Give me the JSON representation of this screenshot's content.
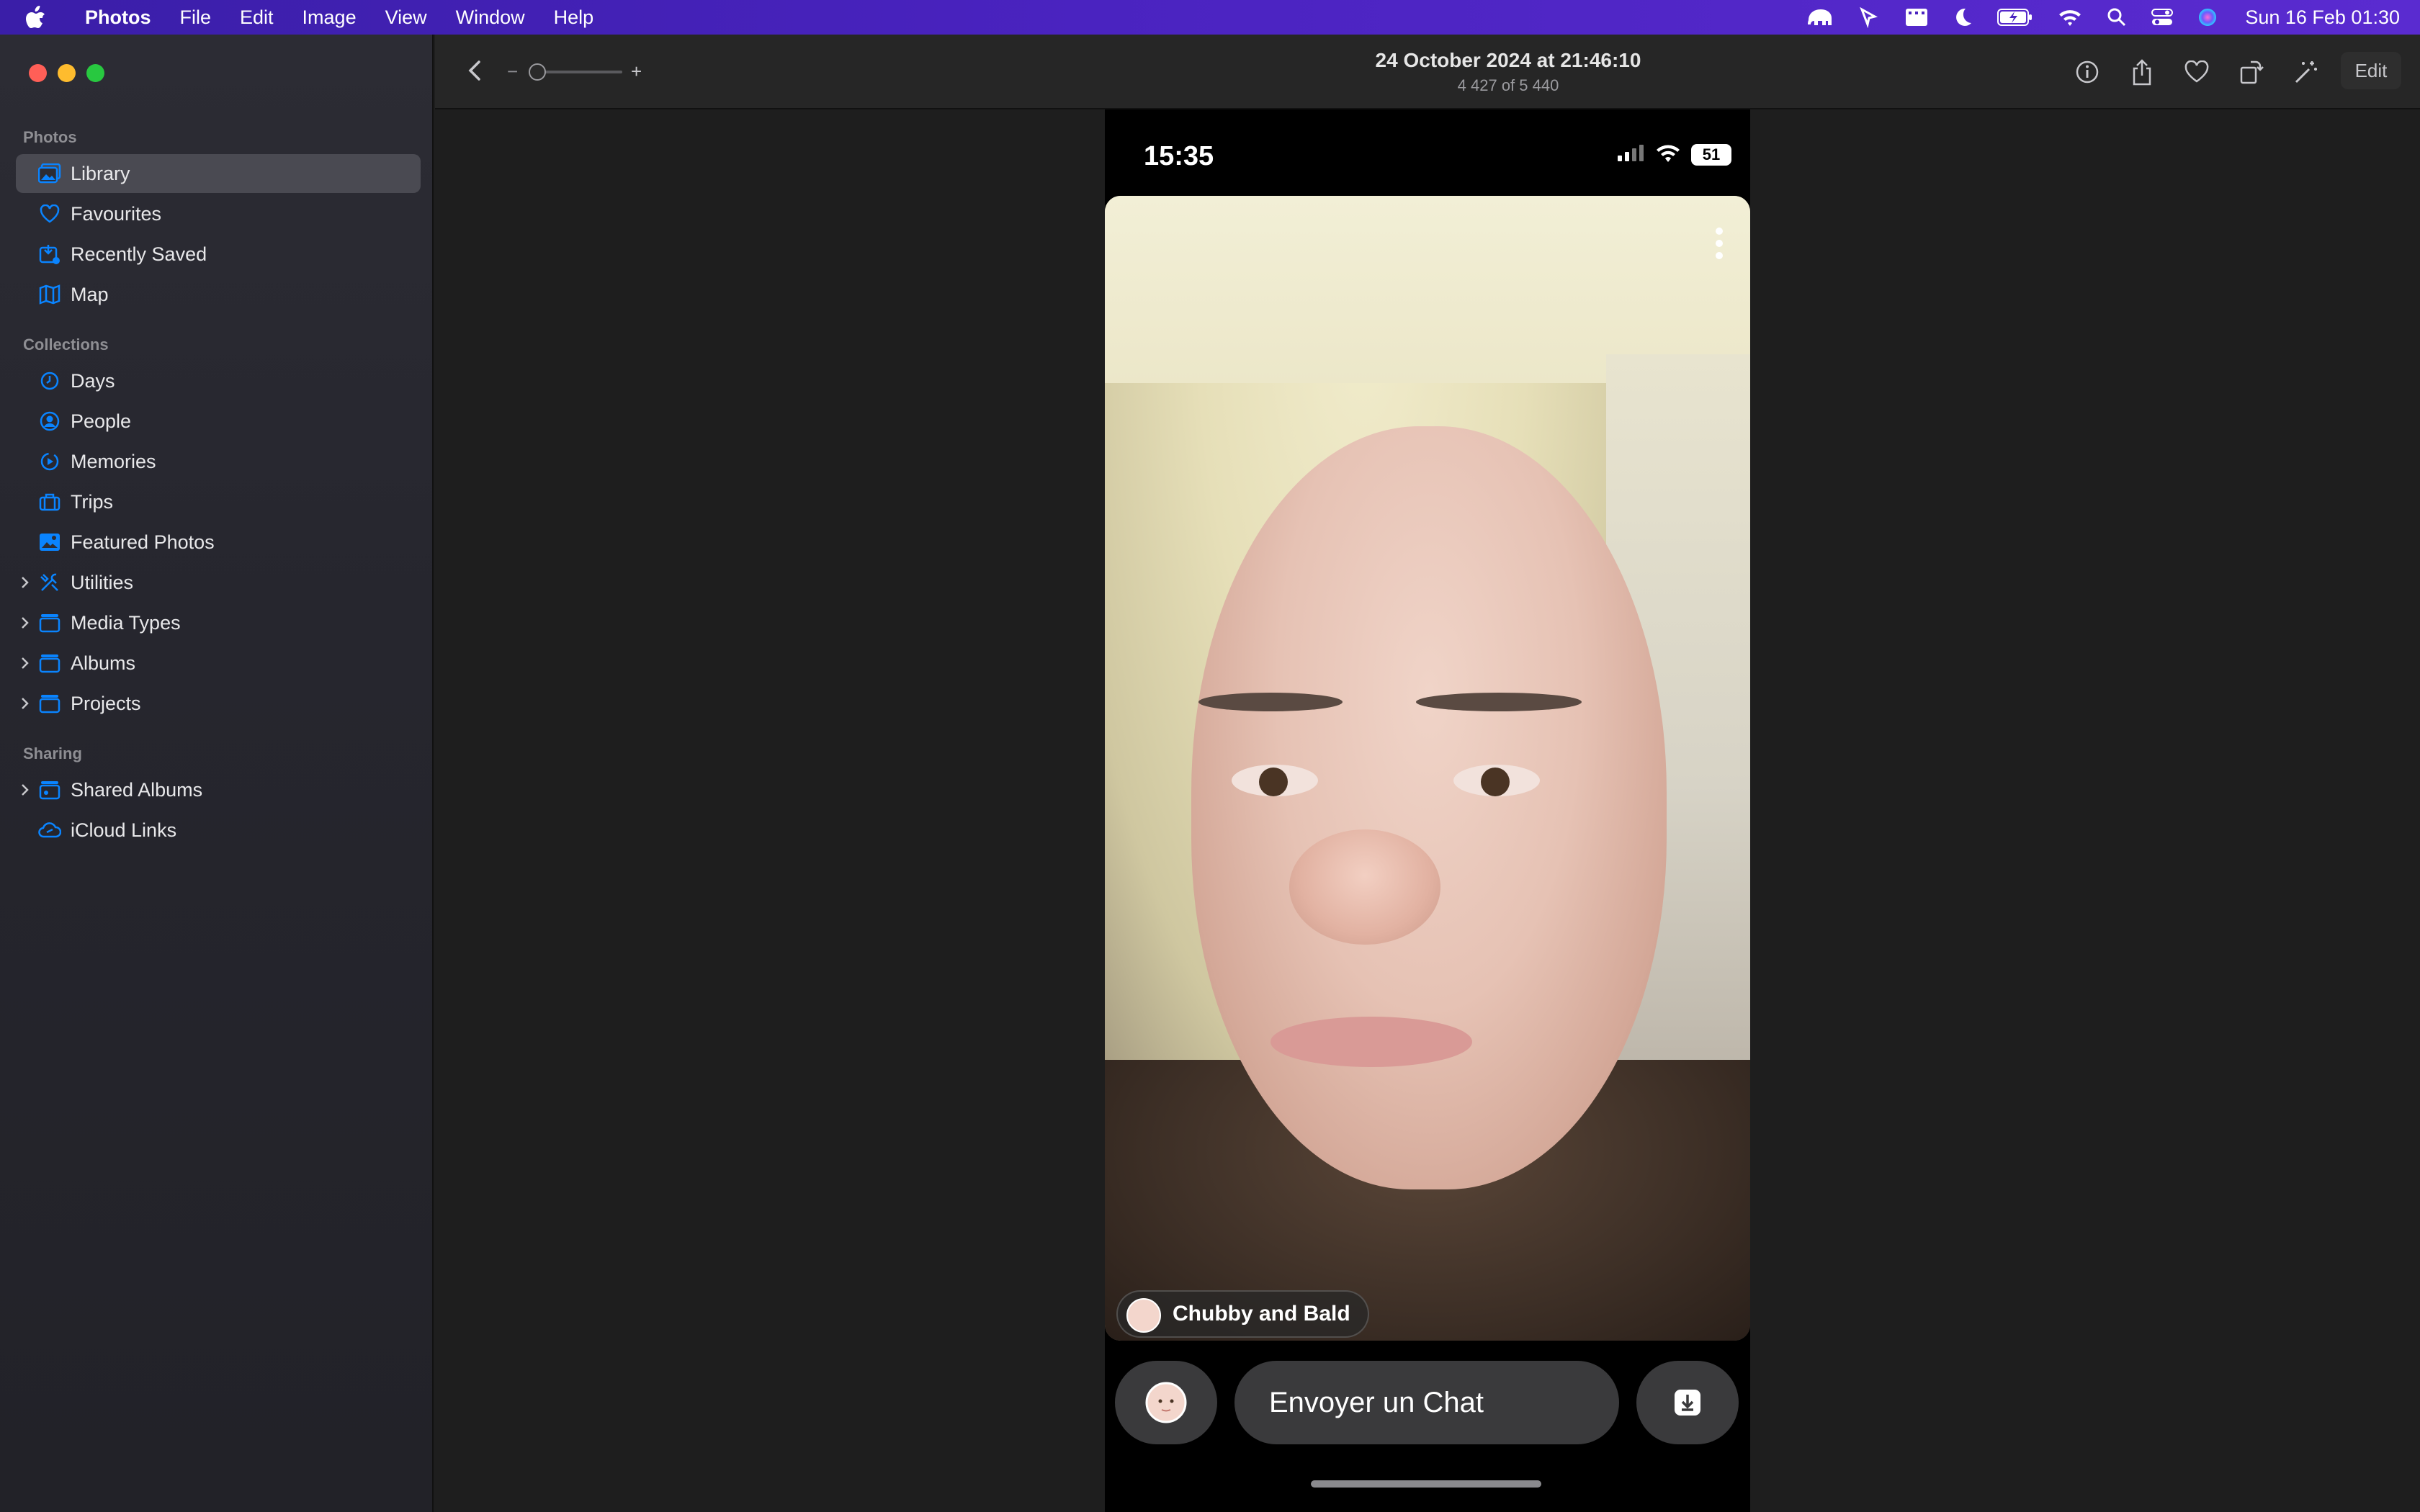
{
  "menubar": {
    "app_name": "Photos",
    "menus": [
      "File",
      "Edit",
      "Image",
      "View",
      "Window",
      "Help"
    ],
    "battery_charging": true,
    "clock": "Sun 16 Feb  01:30"
  },
  "sidebar": {
    "sections": {
      "photos": "Photos",
      "collections": "Collections",
      "sharing": "Sharing"
    },
    "items": [
      {
        "label": "Library",
        "icon": "library-icon",
        "selected": true
      },
      {
        "label": "Favourites",
        "icon": "heart-icon"
      },
      {
        "label": "Recently Saved",
        "icon": "recently-saved-icon"
      },
      {
        "label": "Map",
        "icon": "map-icon"
      },
      {
        "label": "Days",
        "icon": "clock-icon"
      },
      {
        "label": "People",
        "icon": "person-icon"
      },
      {
        "label": "Memories",
        "icon": "memories-icon"
      },
      {
        "label": "Trips",
        "icon": "suitcase-icon"
      },
      {
        "label": "Featured Photos",
        "icon": "featured-photos-icon"
      },
      {
        "label": "Utilities",
        "icon": "utilities-icon",
        "expandable": true
      },
      {
        "label": "Media Types",
        "icon": "folder-icon",
        "expandable": true
      },
      {
        "label": "Albums",
        "icon": "folder-icon",
        "expandable": true
      },
      {
        "label": "Projects",
        "icon": "folder-icon",
        "expandable": true
      },
      {
        "label": "Shared Albums",
        "icon": "shared-album-icon",
        "expandable": true
      },
      {
        "label": "iCloud Links",
        "icon": "icloud-link-icon"
      }
    ]
  },
  "toolbar": {
    "title": "24 October 2024 at 21:46:10",
    "subtitle": "4 427 of 5 440",
    "zoom_minus": "−",
    "zoom_plus": "+",
    "edit_label": "Edit"
  },
  "photo": {
    "phone_time": "15:35",
    "battery": "51",
    "lens_name": "Chubby and Bald",
    "chat_placeholder": "Envoyer un Chat"
  },
  "colors": {
    "accent": "#0a84ff",
    "sidebar_selected": "#4a4a52",
    "traffic_red": "#ff5f57",
    "traffic_yellow": "#febc2e",
    "traffic_green": "#28c840"
  }
}
